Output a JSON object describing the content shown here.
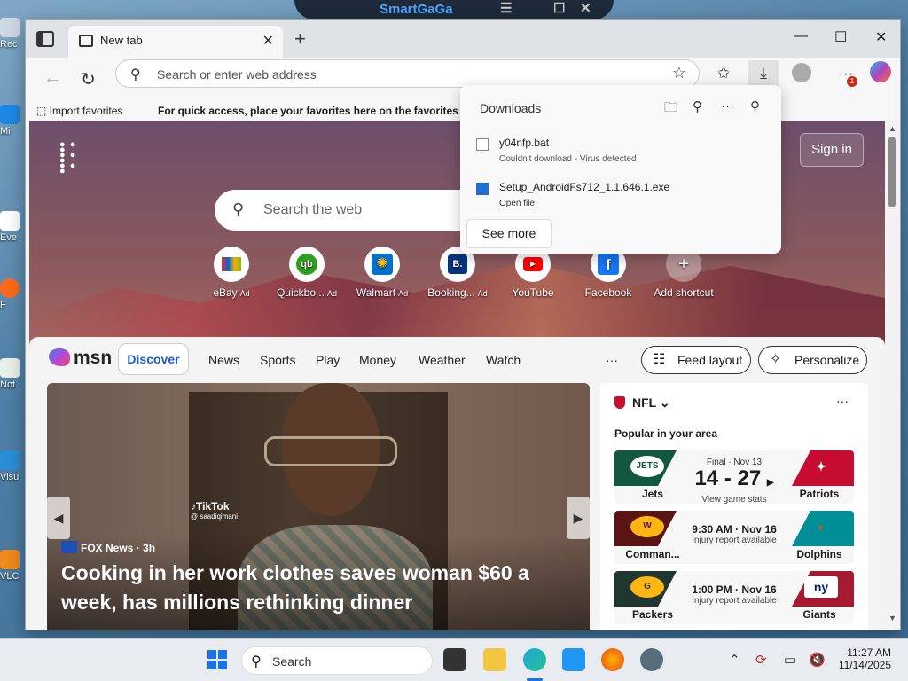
{
  "desktop": {
    "icons": [
      "Rec",
      "Mi",
      "Eve",
      "F",
      "Not",
      "Visu",
      "VLC"
    ]
  },
  "background_app": {
    "title": "SmartGaGa"
  },
  "browser": {
    "tab_title": "New tab",
    "address_placeholder": "Search or enter web address",
    "import_favorites": "Import favorites",
    "favorites_hint": "For quick access, place your favorites here on the favorites bar.",
    "notification_badge": "1"
  },
  "downloads": {
    "title": "Downloads",
    "items": [
      {
        "name": "y04nfp.bat",
        "status": "Couldn't download - Virus detected"
      },
      {
        "name": "Setup_AndroidFs712_1.1.646.1.exe",
        "status": "Open file"
      }
    ],
    "see_more": "See more"
  },
  "newtab": {
    "sign_in": "Sign in",
    "search_placeholder": "Search the web",
    "shortcuts": [
      {
        "label": "eBay",
        "ad": "Ad"
      },
      {
        "label": "Quickbo...",
        "ad": "Ad"
      },
      {
        "label": "Walmart",
        "ad": "Ad"
      },
      {
        "label": "Booking...",
        "ad": "Ad"
      },
      {
        "label": "YouTube",
        "ad": ""
      },
      {
        "label": "Facebook",
        "ad": ""
      },
      {
        "label": "Add shortcut",
        "ad": ""
      }
    ]
  },
  "feed": {
    "brand": "msn",
    "nav": [
      "Discover",
      "News",
      "Sports",
      "Play",
      "Money",
      "Weather",
      "Watch"
    ],
    "more": "···",
    "feed_layout": "Feed layout",
    "personalize": "Personalize",
    "hero": {
      "watermark": "TikTok",
      "watermark_handle": "@ saadiqimani",
      "source": "FOX News",
      "age": "3h",
      "headline": "Cooking in her work clothes saves woman $60 a week, has millions rethinking dinner"
    },
    "nfl": {
      "title": "NFL",
      "subtitle": "Popular in your area",
      "games": [
        {
          "home": "Jets",
          "away": "Patriots",
          "home_logo": "JETS",
          "away_logo": "✦",
          "top": "Final · Nov 13",
          "main": "14 - 27",
          "bottom": "View game stats",
          "home_color": "#125740",
          "away_color": "#c60c30"
        },
        {
          "home": "Comman...",
          "away": "Dolphins",
          "home_logo": "W",
          "away_logo": "◗",
          "top": "9:30 AM · Nov 16",
          "main": "",
          "bottom": "Injury report available",
          "home_color": "#5a1414",
          "away_color": "#008e97"
        },
        {
          "home": "Packers",
          "away": "Giants",
          "home_logo": "G",
          "away_logo": "ny",
          "top": "1:00 PM · Nov 16",
          "main": "",
          "bottom": "Injury report available",
          "home_color": "#203731",
          "away_color": "#a71930"
        }
      ]
    }
  },
  "taskbar": {
    "search": "Search",
    "time": "11:27 AM",
    "date": "11/14/2025"
  }
}
